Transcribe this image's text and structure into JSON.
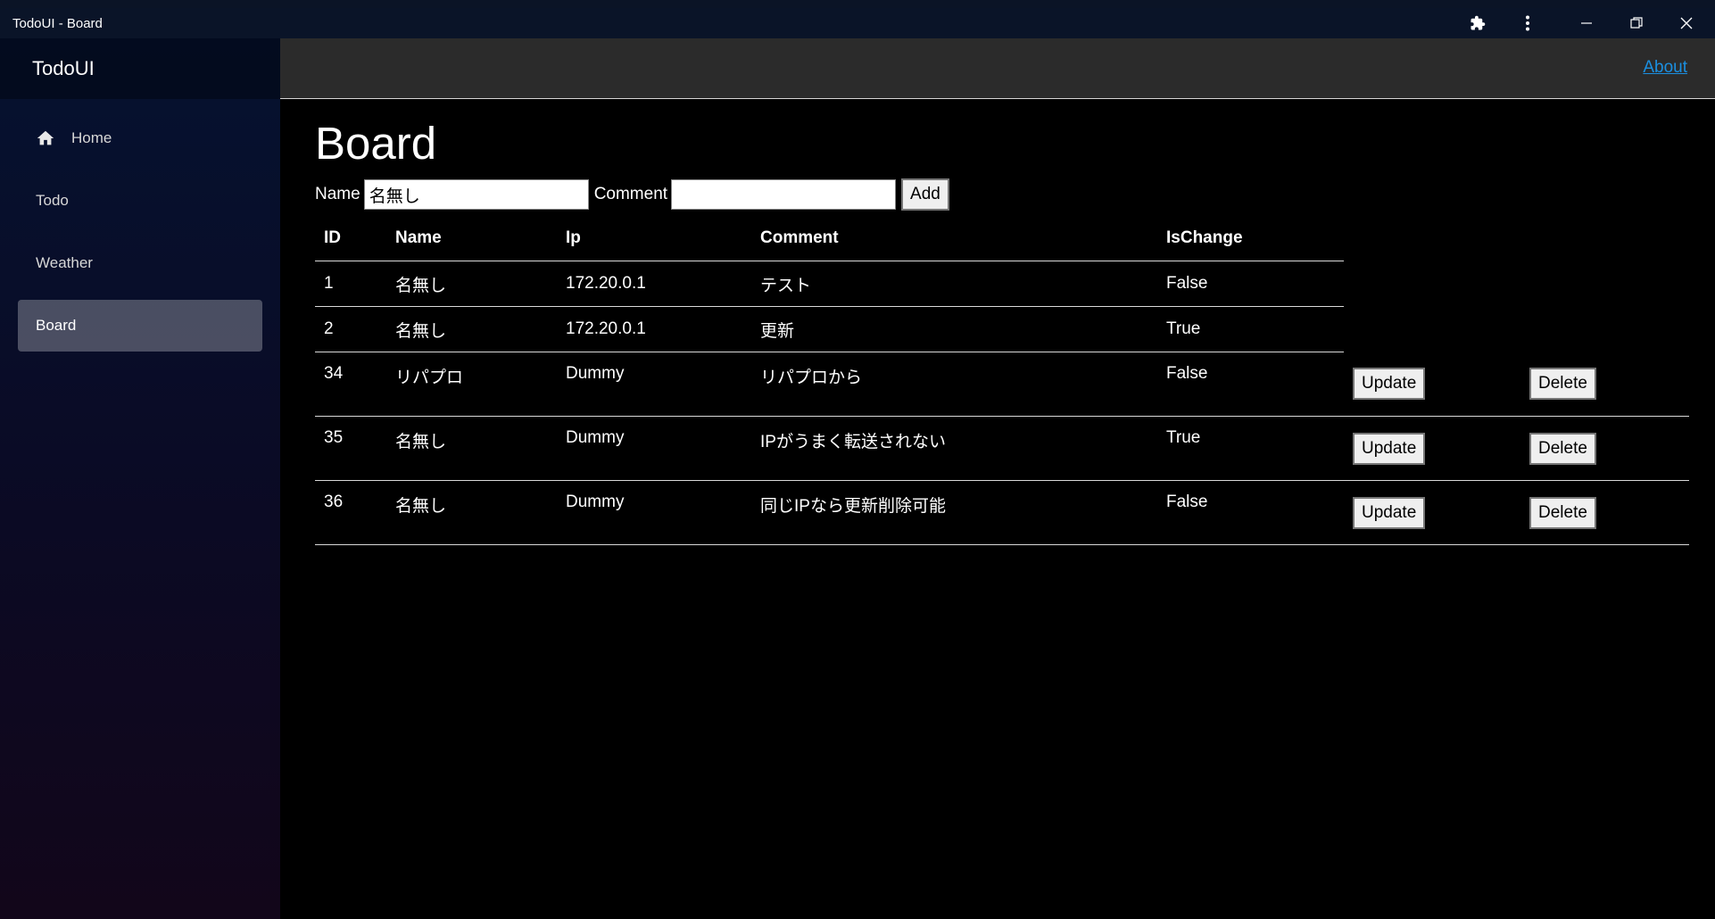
{
  "window": {
    "title": "TodoUI - Board",
    "extensions_icon": "puzzle-icon",
    "menu_icon": "kebab-menu-icon"
  },
  "sidebar": {
    "brand": "TodoUI",
    "items": [
      {
        "label": "Home",
        "icon": "home-icon",
        "active": false
      },
      {
        "label": "Todo",
        "active": false
      },
      {
        "label": "Weather",
        "active": false
      },
      {
        "label": "Board",
        "active": true
      }
    ]
  },
  "topbar": {
    "about_link": "About"
  },
  "main": {
    "title": "Board",
    "form": {
      "name_label": "Name",
      "name_value": "名無し",
      "comment_label": "Comment",
      "comment_value": "",
      "add_label": "Add"
    },
    "table": {
      "headers": [
        "ID",
        "Name",
        "Ip",
        "Comment",
        "IsChange"
      ],
      "rows": [
        {
          "id": "1",
          "name": "名無し",
          "ip": "172.20.0.1",
          "comment": "テスト",
          "is_change": "False",
          "editable": false
        },
        {
          "id": "2",
          "name": "名無し",
          "ip": "172.20.0.1",
          "comment": "更新",
          "is_change": "True",
          "editable": false
        },
        {
          "id": "34",
          "name": "リパプロ",
          "ip": "Dummy",
          "comment": "リパプロから",
          "is_change": "False",
          "editable": true
        },
        {
          "id": "35",
          "name": "名無し",
          "ip": "Dummy",
          "comment": "IPがうまく転送されない",
          "is_change": "True",
          "editable": true
        },
        {
          "id": "36",
          "name": "名無し",
          "ip": "Dummy",
          "comment": "同じIPなら更新削除可能",
          "is_change": "False",
          "editable": true
        }
      ],
      "update_label": "Update",
      "delete_label": "Delete"
    }
  },
  "colors": {
    "link": "#1b8fe0",
    "active_nav_bg": "rgba(255,255,255,0.27)",
    "topbar_bg": "#2b2b2b"
  }
}
